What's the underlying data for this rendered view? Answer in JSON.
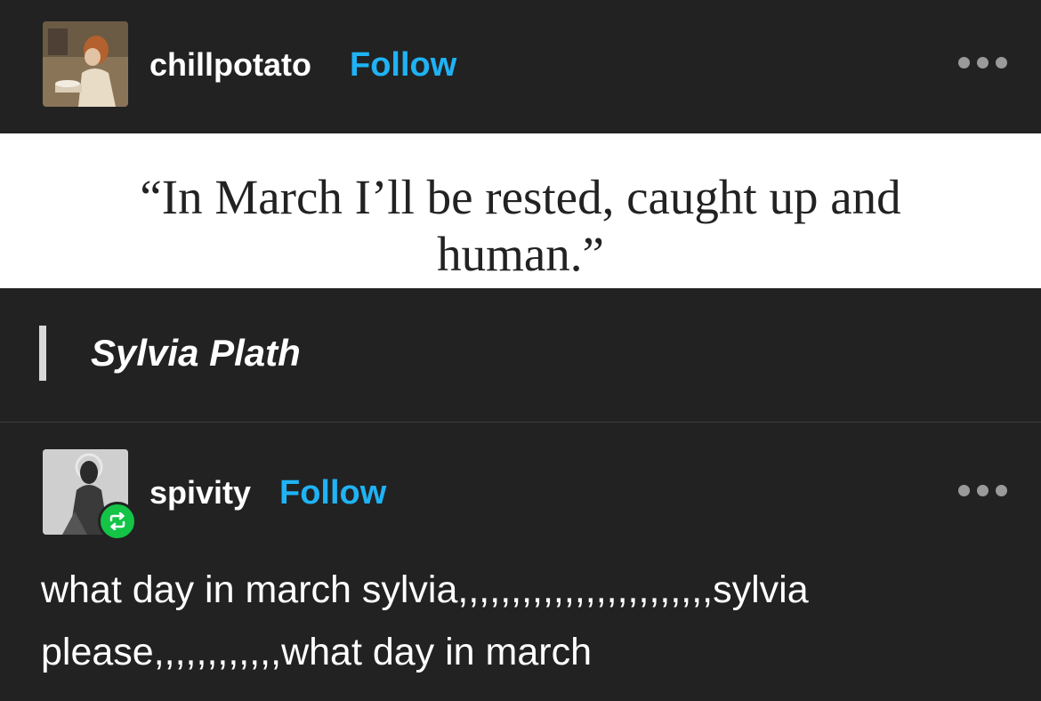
{
  "posts": [
    {
      "username": "chillpotato",
      "follow_label": "Follow",
      "avatar_icon": "painting-avatar-icon",
      "menu_icon": "more-options-icon"
    },
    {
      "username": "spivity",
      "follow_label": "Follow",
      "avatar_icon": "portrait-avatar-icon",
      "badge_icon": "reblog-icon",
      "menu_icon": "more-options-icon"
    }
  ],
  "quote": {
    "lines": [
      "“In March I’ll be rested, caught up and",
      "human.”"
    ],
    "attribution": "Sylvia Plath"
  },
  "comment": {
    "lines": [
      "what day in march sylvia,,,,,,,,,,,,,,,,,,,,,,,,sylvia",
      "please,,,,,,,,,,,,what day in march"
    ]
  },
  "colors": {
    "background": "#222222",
    "follow": "#1fb3f5",
    "reblog_badge": "#13c447",
    "quote_bg": "#ffffff"
  }
}
